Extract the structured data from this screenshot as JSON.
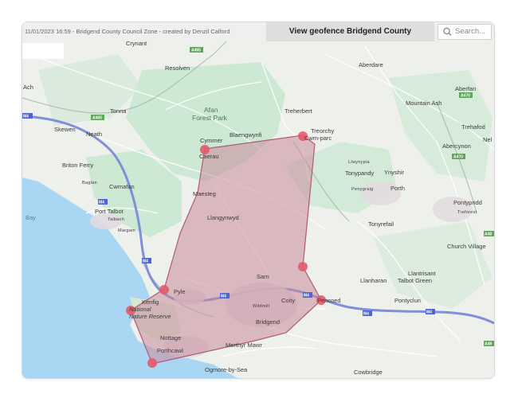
{
  "header": {
    "meta_text": "11/01/2023 16:59 - Bridgend County Council Zone - created by Denzil Calford",
    "view_button": "View geofence Bridgend County",
    "search_placeholder": "Search..."
  },
  "map": {
    "colors": {
      "land": "#eef0ec",
      "sea": "#a9d7f3",
      "park": "#cde8d3",
      "polygon_fill": "#c98b9b",
      "polygon_stroke": "#b05a78",
      "marker": "#e45a6a",
      "motorway": "#7f8fd9"
    },
    "place_labels": [
      "Crynant",
      "Resolven",
      "Aberdare",
      "Aberfan",
      "Mountain Ash",
      "Trehafod",
      "Abercynon",
      "Nel",
      "Tonna",
      "Skewen",
      "Neath",
      "Afan",
      "Forest Park",
      "Treherbert",
      "Treorchy",
      "Cwm-parc",
      "Blaengwynfi",
      "Cymmer",
      "Caerau",
      "Briton Ferry",
      "Baglan",
      "Cwmafan",
      "Port Talbot",
      "Taibach",
      "Margam",
      "Maesteg",
      "Llangynwyd",
      "Llwynypia",
      "Tonypandy",
      "Ynyshir",
      "Penygraig",
      "Porth",
      "Pontypridd",
      "Treforest",
      "Tonyrefail",
      "Church Village",
      "Llantrisant",
      "Talbot Green",
      "Llanharan",
      "Pontyclun",
      "Sarn",
      "Pyle",
      "Kenfig",
      "National",
      "Nature Reserve",
      "Bridgend",
      "Coity",
      "Wildmill",
      "Pencoed",
      "Nottage",
      "Porthcawl",
      "Merthyr Mawr",
      "Ogmore-by-Sea",
      "Cowbridge",
      "Bay",
      "Ach"
    ],
    "road_shields": [
      "A465",
      "M4",
      "A4109",
      "A4059",
      "A470",
      "A48"
    ]
  }
}
